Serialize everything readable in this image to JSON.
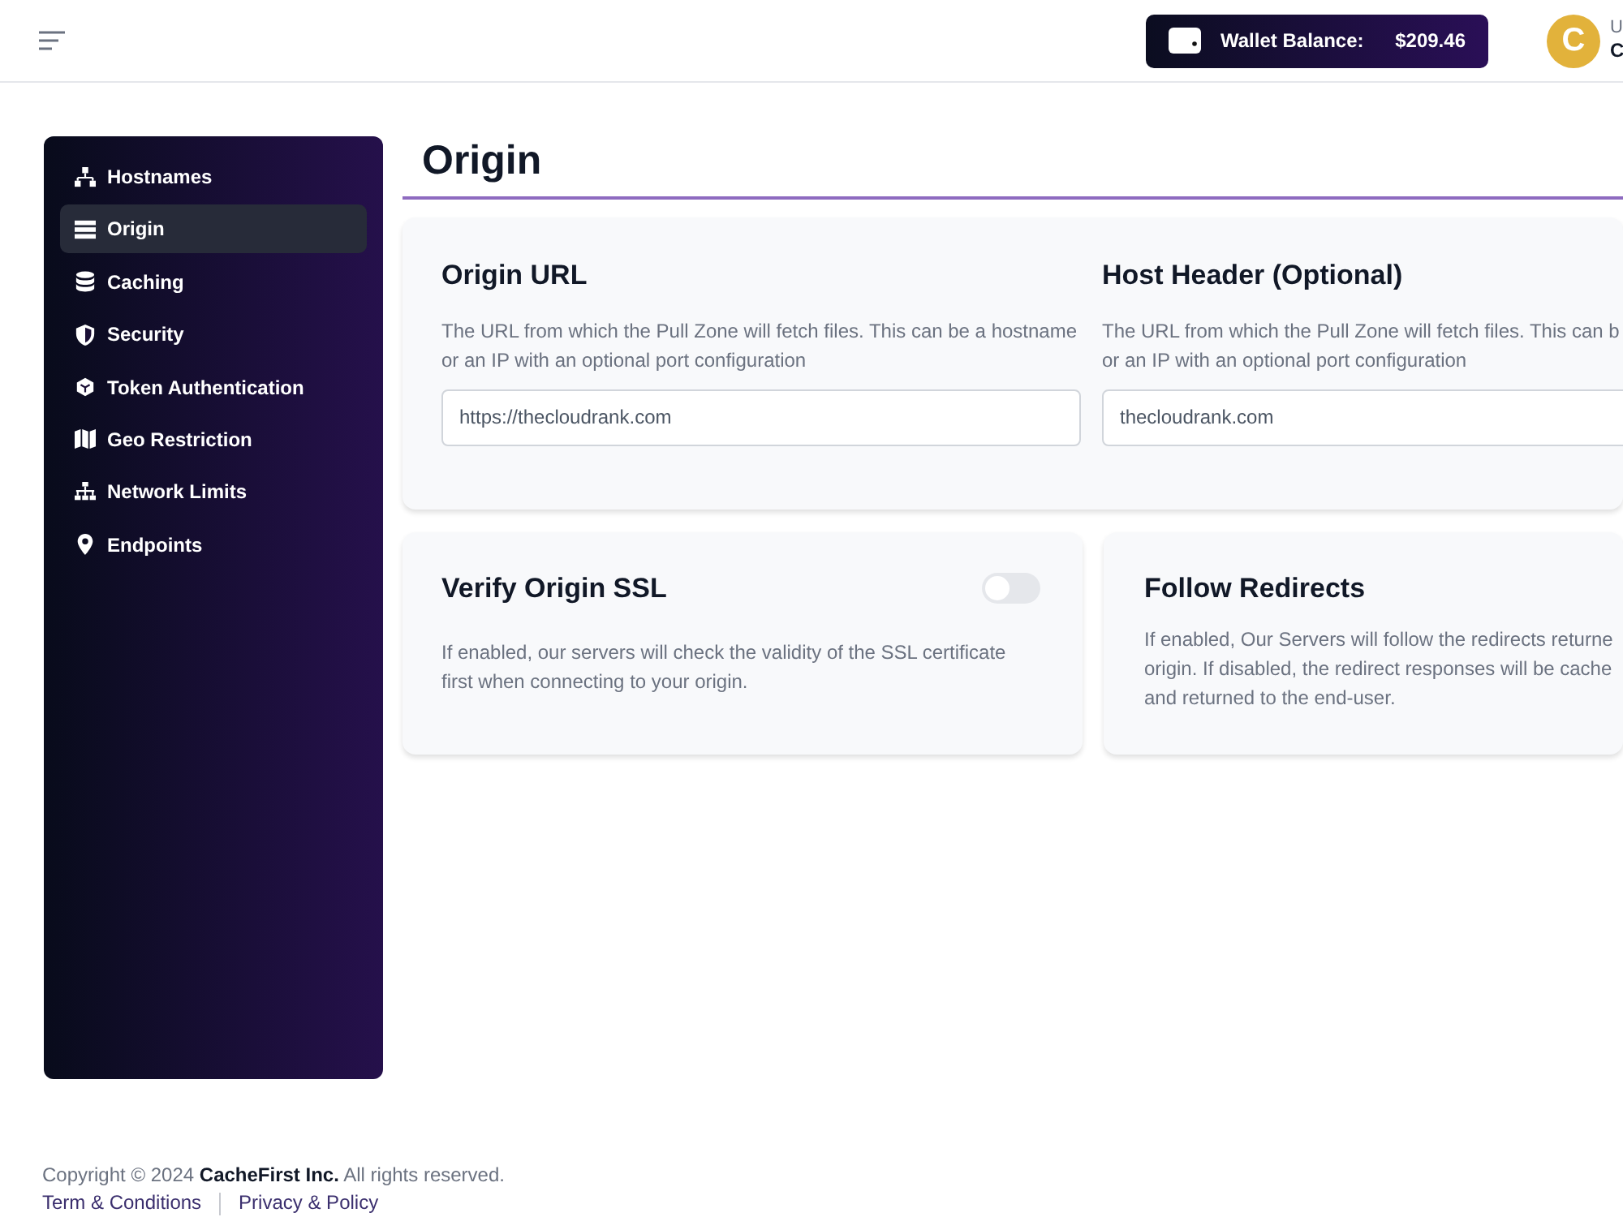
{
  "header": {
    "wallet": {
      "label": "Wallet Balance:",
      "amount": "$209.46"
    },
    "user": {
      "avatar": "C",
      "line_1": "U",
      "line_2": "C"
    }
  },
  "sidebar": {
    "items": [
      {
        "label": "Hostnames",
        "kind": "sitemap",
        "selected": false
      },
      {
        "label": "Origin",
        "kind": "server",
        "selected": true
      },
      {
        "label": "Caching",
        "kind": "database",
        "selected": false
      },
      {
        "label": "Security",
        "kind": "shield",
        "selected": false
      },
      {
        "label": "Token Authentication",
        "kind": "cube",
        "selected": false
      },
      {
        "label": "Geo Restriction",
        "kind": "map",
        "selected": false
      },
      {
        "label": "Network Limits",
        "kind": "network",
        "selected": false
      },
      {
        "label": "Endpoints",
        "kind": "pin",
        "selected": false
      }
    ]
  },
  "page_title": "Origin",
  "fields": [
    {
      "label": "Origin URL",
      "description": "The URL from which the Pull Zone will fetch files. This can be a hostname or an IP with an optional port configuration",
      "value": "https://thecloudrank.com"
    },
    {
      "label": "Host Header (Optional)",
      "description": "The URL from which the Pull Zone will fetch files. This can b or an IP with an optional port configuration",
      "value": "thecloudrank.com"
    }
  ],
  "toggles": [
    {
      "title": "Verify Origin SSL",
      "description": "If enabled, our servers will check the validity of the SSL certificate first when connecting to your origin.",
      "on": false,
      "kind": "switch"
    },
    {
      "title": "Follow Redirects",
      "description": "If enabled, Our Servers will follow the redirects returne origin. If disabled, the redirect responses will be cache and returned to the end-user.",
      "kind": "plain"
    }
  ],
  "footer": {
    "copyright": "Copyright © 2024 **CacheFirst Inc.** All rights reserved.",
    "links": [
      "Term & Conditions",
      "Privacy & Policy"
    ]
  }
}
